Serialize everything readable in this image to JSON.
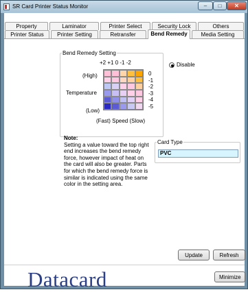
{
  "window": {
    "title": "SR Card Printer Status Monitor",
    "controls": {
      "minimize": "–",
      "maximize": "□",
      "close": "✕"
    }
  },
  "tabs": {
    "row1": [
      "Property",
      "Laminator",
      "Printer Select",
      "Security Lock",
      "Others"
    ],
    "row2": [
      "Printer Status",
      "Printer Setting",
      "Retransfer",
      "Bend Remedy",
      "Media Setting"
    ],
    "active": "Bend Remedy"
  },
  "bend_remedy": {
    "group_label": "Bend Remedy Setting",
    "speed_values": "+2 +1  0  -1  -2",
    "temp_scale": [
      "0",
      "-1",
      "-2",
      "-3",
      "-4",
      "-5"
    ],
    "high_label": "(High)",
    "temperature_label": "Temperature",
    "low_label": "(Low)",
    "speed_label": "(Fast)  Speed  (Slow)",
    "disable_label": "Disable",
    "disable_selected": true,
    "grid_colors": [
      [
        "#ffbfd6",
        "#ffbfd6",
        "#ffd6a8",
        "#ffbf3f",
        "#ffa500"
      ],
      [
        "#ffd0e8",
        "#ffc8e0",
        "#ffd6bf",
        "#ffd0a0",
        "#ffbf3f"
      ],
      [
        "#bfc8f5",
        "#d8d0f5",
        "#ffd0e8",
        "#ffc8e0",
        "#ffd0a0"
      ],
      [
        "#9999ee",
        "#c8c0f5",
        "#e8d0f5",
        "#ffd0e8",
        "#ffc8e0"
      ],
      [
        "#5b5bd6",
        "#9090ea",
        "#c0c0f5",
        "#e0d0f5",
        "#ffd0e8"
      ],
      [
        "#2a2ac2",
        "#5b5bd6",
        "#9999ee",
        "#c8c8f5",
        "#f0d8f0"
      ]
    ]
  },
  "note": {
    "title": "Note:",
    "text": "Setting a value toward the top right end increases the bend remedy force, however impact of heat on the card will also be greater.  Parts for which the bend remedy force is similar is indicated using the same color in the setting area."
  },
  "card_type": {
    "label": "Card Type",
    "value": "PVC"
  },
  "buttons": {
    "update": "Update",
    "refresh": "Refresh",
    "minimize": "Minimize"
  },
  "brand": "Datacard"
}
